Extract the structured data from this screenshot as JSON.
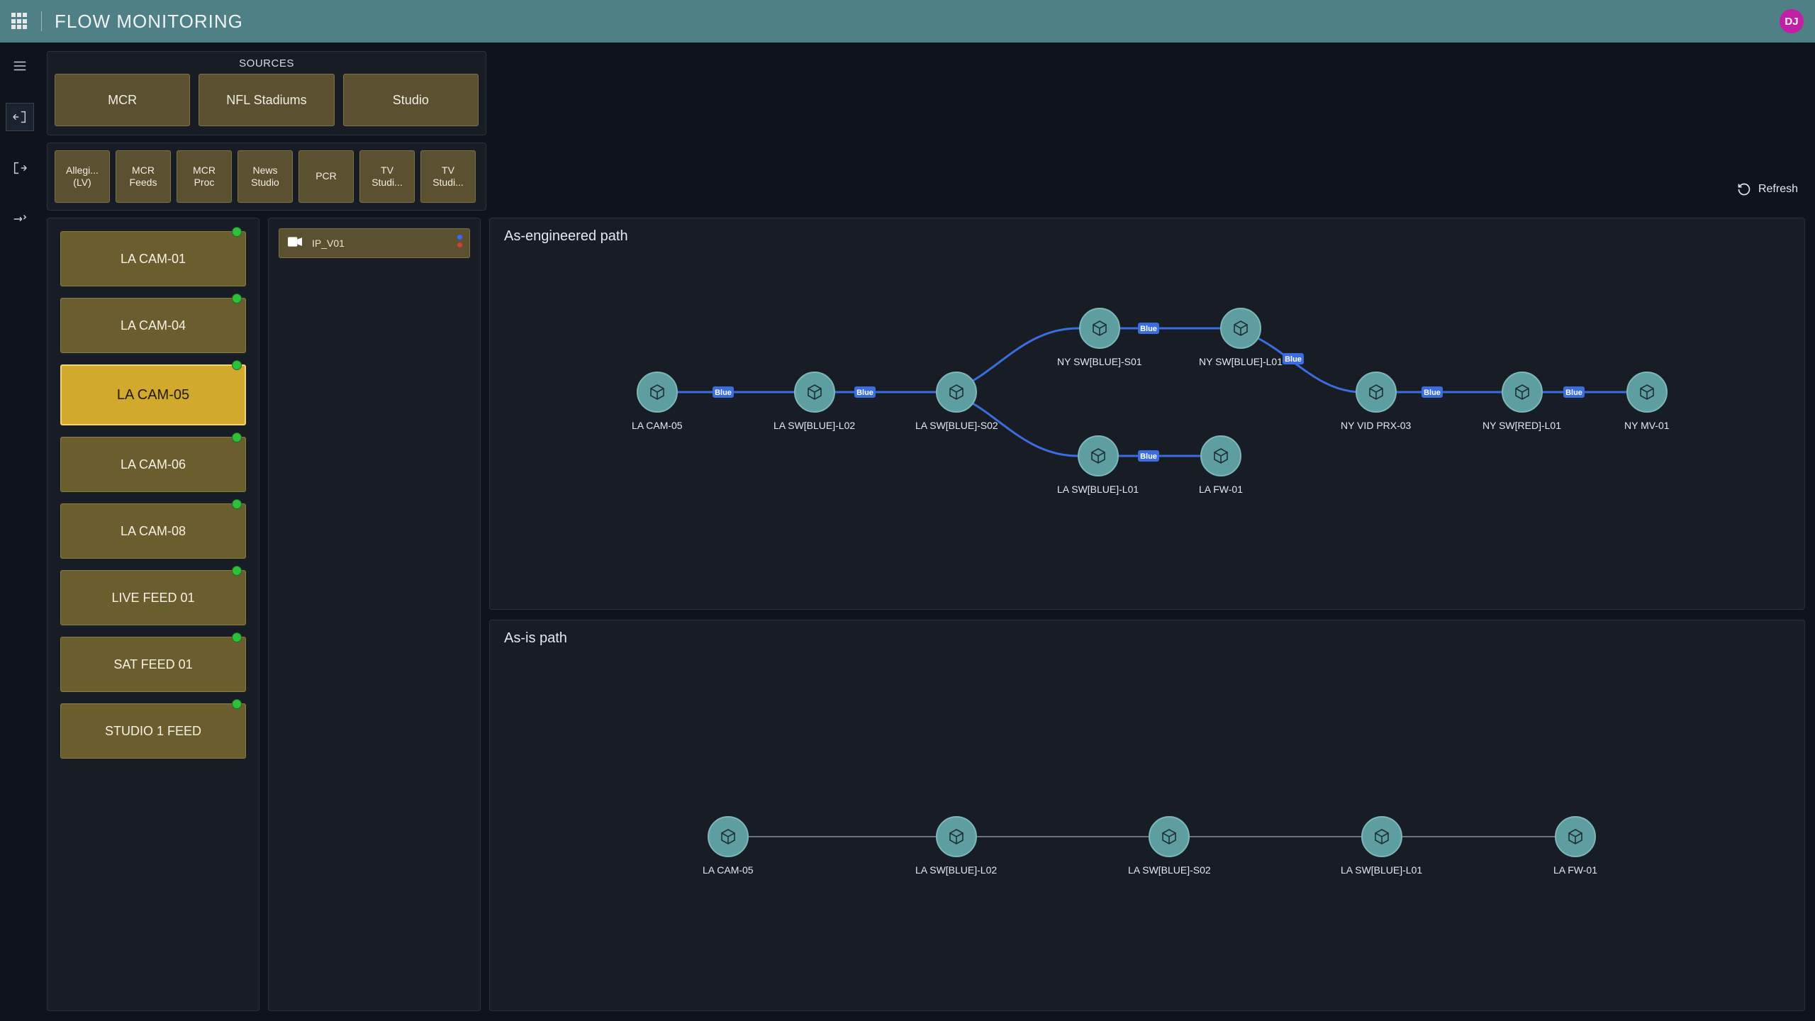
{
  "header": {
    "title": "FLOW MONITORING",
    "avatar": "DJ"
  },
  "sources": {
    "heading": "SOURCES",
    "categories": [
      "MCR",
      "NFL Stadiums",
      "Studio"
    ],
    "subcategories": [
      "Allegi... (LV)",
      "MCR Feeds",
      "MCR Proc",
      "News Studio",
      "PCR",
      "TV Studi...",
      "TV Studi..."
    ]
  },
  "source_list": [
    {
      "label": "LA CAM-01",
      "status": "ok",
      "selected": false
    },
    {
      "label": "LA CAM-04",
      "status": "ok",
      "selected": false
    },
    {
      "label": "LA CAM-05",
      "status": "ok",
      "selected": true
    },
    {
      "label": "LA CAM-06",
      "status": "ok",
      "selected": false
    },
    {
      "label": "LA CAM-08",
      "status": "ok",
      "selected": false
    },
    {
      "label": "LIVE FEED 01",
      "status": "ok",
      "selected": false
    },
    {
      "label": "SAT FEED 01",
      "status": "ok",
      "selected": false
    },
    {
      "label": "STUDIO 1 FEED",
      "status": "ok",
      "selected": false
    }
  ],
  "flow_item": {
    "label": "IP_V01"
  },
  "refresh_label": "Refresh",
  "panel_titles": {
    "engineered": "As-engineered path",
    "asis": "As-is path"
  },
  "engineered_nodes": {
    "n0": "LA CAM-05",
    "n1": "LA SW[BLUE]-L02",
    "n2": "LA SW[BLUE]-S02",
    "n3a": "NY SW[BLUE]-S01",
    "n3b": "LA SW[BLUE]-L01",
    "n4a": "NY SW[BLUE]-L01",
    "n4b": "LA FW-01",
    "n5": "NY VID PRX-03",
    "n6": "NY SW[RED]-L01",
    "n7": "NY MV-01"
  },
  "asis_nodes": {
    "a0": "LA CAM-05",
    "a1": "LA SW[BLUE]-L02",
    "a2": "LA SW[BLUE]-S02",
    "a3": "LA SW[BLUE]-L01",
    "a4": "LA FW-01"
  },
  "edge_label": "Blue"
}
